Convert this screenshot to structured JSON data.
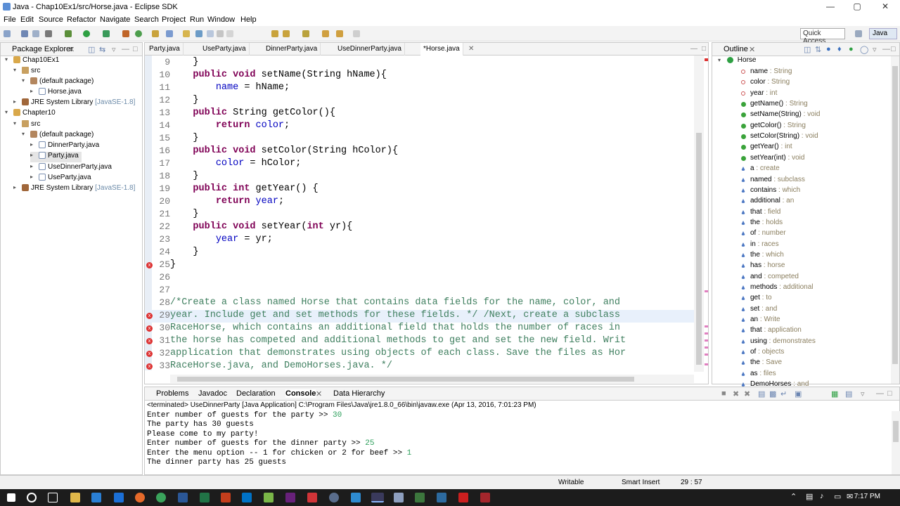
{
  "window": {
    "title": "Java - Chap10Ex1/src/Horse.java - Eclipse SDK"
  },
  "menu": [
    "File",
    "Edit",
    "Source",
    "Refactor",
    "Navigate",
    "Search",
    "Project",
    "Run",
    "Window",
    "Help"
  ],
  "toolbar": {
    "quick_access": "Quick Access",
    "perspective": "Java"
  },
  "package_explorer": {
    "title": "Package Explorer",
    "items": [
      {
        "label": "Chap10Ex1",
        "extra": "",
        "icon": "project-icon"
      },
      {
        "label": "src",
        "extra": "",
        "icon": "source-folder-icon"
      },
      {
        "label": "(default package)",
        "extra": "",
        "icon": "package-icon"
      },
      {
        "label": "Horse.java",
        "extra": "",
        "icon": "java-file-icon"
      },
      {
        "label": "JRE System Library",
        "extra": "[JavaSE-1.8]",
        "icon": "library-icon"
      },
      {
        "label": "Chapter10",
        "extra": "",
        "icon": "project-icon"
      },
      {
        "label": "src",
        "extra": "",
        "icon": "source-folder-icon"
      },
      {
        "label": "(default package)",
        "extra": "",
        "icon": "package-icon"
      },
      {
        "label": "DinnerParty.java",
        "extra": "",
        "icon": "java-file-icon"
      },
      {
        "label": "Party.java",
        "extra": "",
        "icon": "java-file-icon"
      },
      {
        "label": "UseDinnerParty.java",
        "extra": "",
        "icon": "java-file-icon"
      },
      {
        "label": "UseParty.java",
        "extra": "",
        "icon": "java-file-icon"
      },
      {
        "label": "JRE System Library",
        "extra": "[JavaSE-1.8]",
        "icon": "library-icon"
      }
    ]
  },
  "editor": {
    "tabs": [
      "Party.java",
      "UseParty.java",
      "DinnerParty.java",
      "UseDinnerParty.java",
      "*Horse.java"
    ],
    "lines": [
      {
        "n": "9",
        "text": "    }"
      },
      {
        "n": "10",
        "text": "    public void setName(String hName){"
      },
      {
        "n": "11",
        "text": "        name = hName;"
      },
      {
        "n": "12",
        "text": "    }"
      },
      {
        "n": "13",
        "text": "    public String getColor(){"
      },
      {
        "n": "14",
        "text": "        return color;"
      },
      {
        "n": "15",
        "text": "    }"
      },
      {
        "n": "16",
        "text": "    public void setColor(String hColor){"
      },
      {
        "n": "17",
        "text": "        color = hColor;"
      },
      {
        "n": "18",
        "text": "    }"
      },
      {
        "n": "19",
        "text": "    public int getYear() {"
      },
      {
        "n": "20",
        "text": "        return year;"
      },
      {
        "n": "21",
        "text": "    }"
      },
      {
        "n": "22",
        "text": "    public void setYear(int yr){"
      },
      {
        "n": "23",
        "text": "        year = yr;"
      },
      {
        "n": "24",
        "text": "    }"
      },
      {
        "n": "25",
        "text": "}"
      },
      {
        "n": "26",
        "text": ""
      },
      {
        "n": "27",
        "text": ""
      },
      {
        "n": "28",
        "text": "/*Create a class named Horse that contains data fields for the name, color, and"
      },
      {
        "n": "29",
        "text": "year. Include get and set methods for these fields. */ /Next, create a subclass"
      },
      {
        "n": "30",
        "text": "RaceHorse, which contains an additional field that holds the number of races in"
      },
      {
        "n": "31",
        "text": "the horse has competed and additional methods to get and set the new field. Writ"
      },
      {
        "n": "32",
        "text": "application that demonstrates using objects of each class. Save the files as Hor"
      },
      {
        "n": "33",
        "text": "RaceHorse.java, and DemoHorses.java. */"
      }
    ]
  },
  "outline": {
    "title": "Outline",
    "root": "Horse",
    "items": [
      {
        "name": "name",
        "type": " : String"
      },
      {
        "name": "color",
        "type": " : String"
      },
      {
        "name": "year",
        "type": " : int"
      },
      {
        "name": "getName()",
        "type": " : String"
      },
      {
        "name": "setName(String)",
        "type": " : void"
      },
      {
        "name": "getColor()",
        "type": " : String"
      },
      {
        "name": "setColor(String)",
        "type": " : void"
      },
      {
        "name": "getYear()",
        "type": " : int"
      },
      {
        "name": "setYear(int)",
        "type": " : void"
      },
      {
        "name": "a",
        "type": " : create"
      },
      {
        "name": "named",
        "type": " : subclass"
      },
      {
        "name": "contains",
        "type": " : which"
      },
      {
        "name": "additional",
        "type": " : an"
      },
      {
        "name": "that",
        "type": " : field"
      },
      {
        "name": "the",
        "type": " : holds"
      },
      {
        "name": "of",
        "type": " : number"
      },
      {
        "name": "in",
        "type": " : races"
      },
      {
        "name": "the",
        "type": " : which"
      },
      {
        "name": "has",
        "type": " : horse"
      },
      {
        "name": "and",
        "type": " : competed"
      },
      {
        "name": "methods",
        "type": " : additional"
      },
      {
        "name": "get",
        "type": " : to"
      },
      {
        "name": "set",
        "type": " : and"
      },
      {
        "name": "an",
        "type": " : Write"
      },
      {
        "name": "that",
        "type": " : application"
      },
      {
        "name": "using",
        "type": " : demonstrates"
      },
      {
        "name": "of",
        "type": " : objects"
      },
      {
        "name": "the",
        "type": " : Save"
      },
      {
        "name": "as",
        "type": " : files"
      },
      {
        "name": "DemoHorses",
        "type": " : and"
      }
    ]
  },
  "bottom": {
    "tabs": [
      "Problems",
      "Javadoc",
      "Declaration",
      "Console",
      "Data Hierarchy"
    ],
    "header": "<terminated> UseDinnerParty [Java Application] C:\\Program Files\\Java\\jre1.8.0_66\\bin\\javaw.exe (Apr 13, 2016, 7:01:23 PM)",
    "lines": [
      {
        "text": "Enter number of guests for the party >> ",
        "input": "30"
      },
      {
        "text": "The party has 30 guests",
        "input": ""
      },
      {
        "text": "Please come to my party!",
        "input": ""
      },
      {
        "text": "Enter number of guests for the dinner party >> ",
        "input": "25"
      },
      {
        "text": "Enter the menu option -- 1 for chicken or 2 for beef >> ",
        "input": "1"
      },
      {
        "text": "The dinner party has 25 guests",
        "input": ""
      }
    ]
  },
  "status": {
    "writable": "Writable",
    "insert": "Smart Insert",
    "position": "29 : 57"
  },
  "taskbar": {
    "time": "7:17 PM"
  }
}
